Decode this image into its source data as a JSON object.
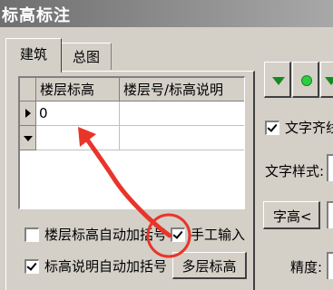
{
  "window": {
    "title": "标高标注"
  },
  "tabs": [
    {
      "label": "建筑",
      "active": true
    },
    {
      "label": "总图",
      "active": false
    }
  ],
  "grid": {
    "columns": [
      "楼层标高",
      "楼层号/标高说明"
    ],
    "rows": [
      {
        "indicator": "current-row-triangle",
        "values": [
          "0",
          ""
        ]
      },
      {
        "indicator": "dropdown-triangle",
        "values": [
          "",
          ""
        ]
      }
    ]
  },
  "options": {
    "auto_bracket_floor_elev": {
      "label": "楼层标高自动加括号",
      "checked": false
    },
    "manual_input": {
      "label": "手工输入",
      "checked": true
    },
    "auto_bracket_elev_note": {
      "label": "标高说明自动加括号",
      "checked": true
    }
  },
  "buttons": {
    "multi_floor": "多层标高",
    "char_height": "字高<"
  },
  "side": {
    "text_align_label": "文字齐线",
    "text_align_checked": true,
    "text_style_label": "文字样式:",
    "precision_label": "精度:"
  },
  "icons": {
    "marker_down": "green-down-triangle-icon",
    "marker_dot": "green-dot-icon"
  },
  "colors": {
    "annotation": "#e8352a",
    "marker_green": "#158a20"
  }
}
